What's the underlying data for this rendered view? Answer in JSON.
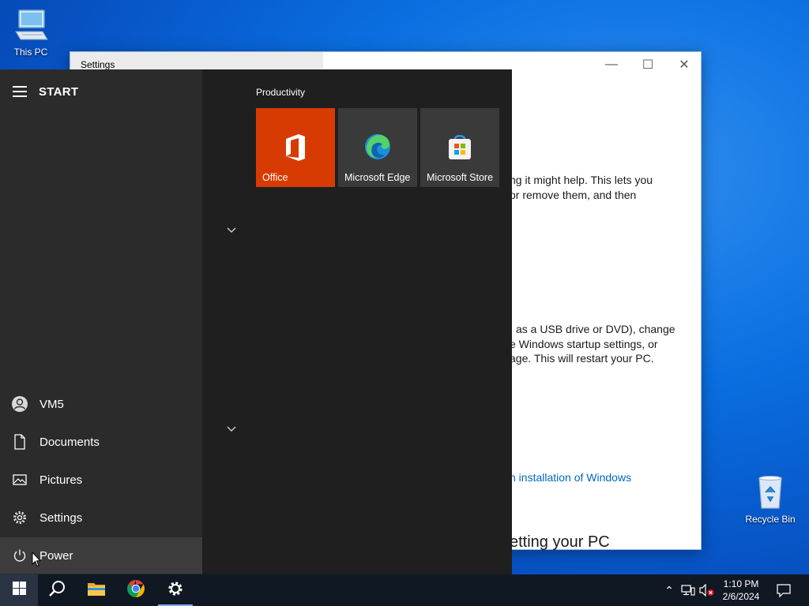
{
  "desktop": {
    "icons": [
      {
        "label": "This PC",
        "icon": "this-pc-icon"
      },
      {
        "label": "Recycle Bin",
        "icon": "recycle-bin-icon"
      }
    ]
  },
  "settings_window": {
    "title": "Settings",
    "controls": {
      "minimize": "—",
      "maximize": "☐",
      "close": "✕"
    },
    "text_lines": [
      "ng it might help. This lets you",
      "or remove them, and then",
      "as a USB drive or DVD), change",
      "e Windows startup settings, or",
      "age. This will restart your PC."
    ],
    "link": "n installation of Windows",
    "heading": "etting your PC"
  },
  "start_menu": {
    "label": "START",
    "user": "VM5",
    "items": [
      {
        "label": "Documents",
        "icon": "document-icon"
      },
      {
        "label": "Pictures",
        "icon": "pictures-icon"
      },
      {
        "label": "Settings",
        "icon": "gear-icon"
      },
      {
        "label": "Power",
        "icon": "power-icon"
      }
    ],
    "group_title": "Productivity",
    "tiles": [
      {
        "label": "Office",
        "icon": "office-icon",
        "color": "#d83b01"
      },
      {
        "label": "Microsoft Edge",
        "icon": "edge-icon",
        "color": "#3a3a3a"
      },
      {
        "label": "Microsoft Store",
        "icon": "store-icon",
        "color": "#3a3a3a"
      }
    ],
    "chevron": "⌄"
  },
  "taskbar": {
    "buttons": [
      "windows-start-icon",
      "search-icon",
      "file-explorer-icon",
      "chrome-icon",
      "settings-gear-icon"
    ],
    "tray": {
      "chevron": "⌃",
      "time": "1:10 PM",
      "date": "2/6/2024"
    }
  }
}
